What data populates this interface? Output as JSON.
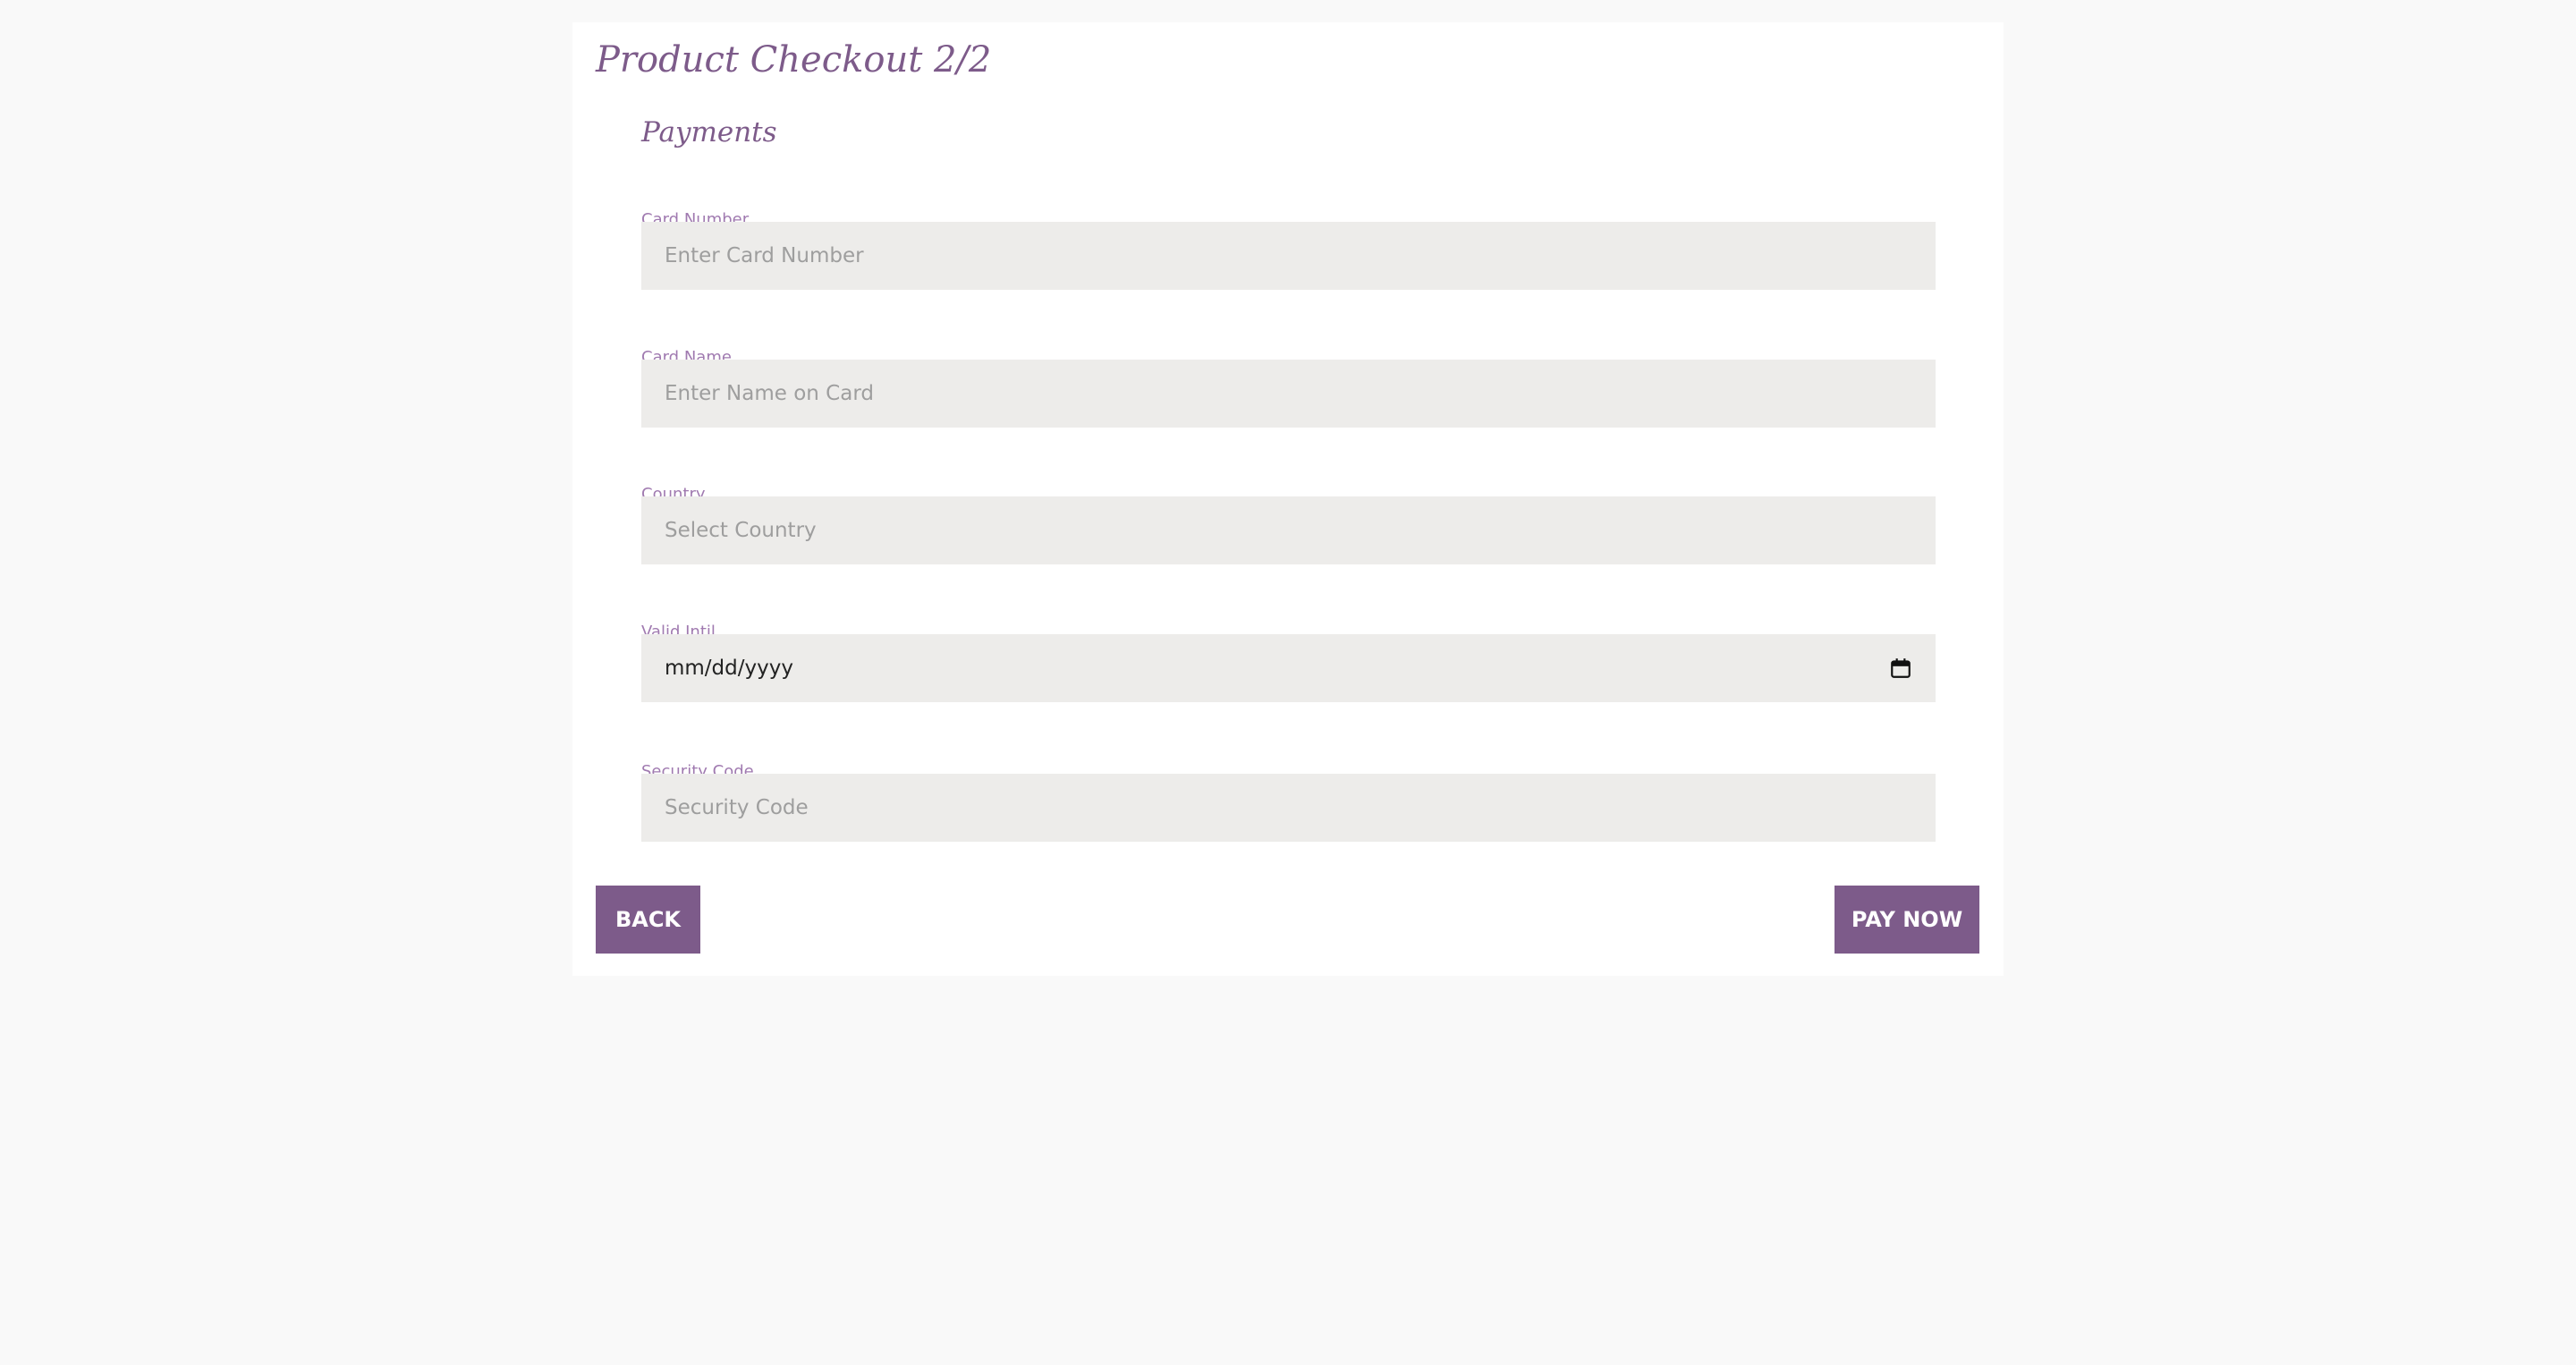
{
  "page": {
    "title": "Product Checkout 2/2"
  },
  "form": {
    "section_title": "Payments",
    "fields": {
      "card_number": {
        "label": "Card Number",
        "placeholder": "Enter Card Number"
      },
      "card_name": {
        "label": "Card Name",
        "placeholder": "Enter Name on Card"
      },
      "country": {
        "label": "Country",
        "placeholder": "Select Country"
      },
      "valid_until": {
        "label": "Valid Intil",
        "value": "mm/dd/yyyy",
        "icon": "calendar-icon"
      },
      "security_code": {
        "label": "Security Code",
        "placeholder": "Security Code"
      }
    }
  },
  "actions": {
    "back_label": "BACK",
    "pay_label": "PAY NOW"
  },
  "colors": {
    "accent": "#7d5b8a",
    "label": "#a07ab0",
    "field_background": "#edecea",
    "page_background": "#f9f9f9",
    "card_background": "#ffffff"
  }
}
